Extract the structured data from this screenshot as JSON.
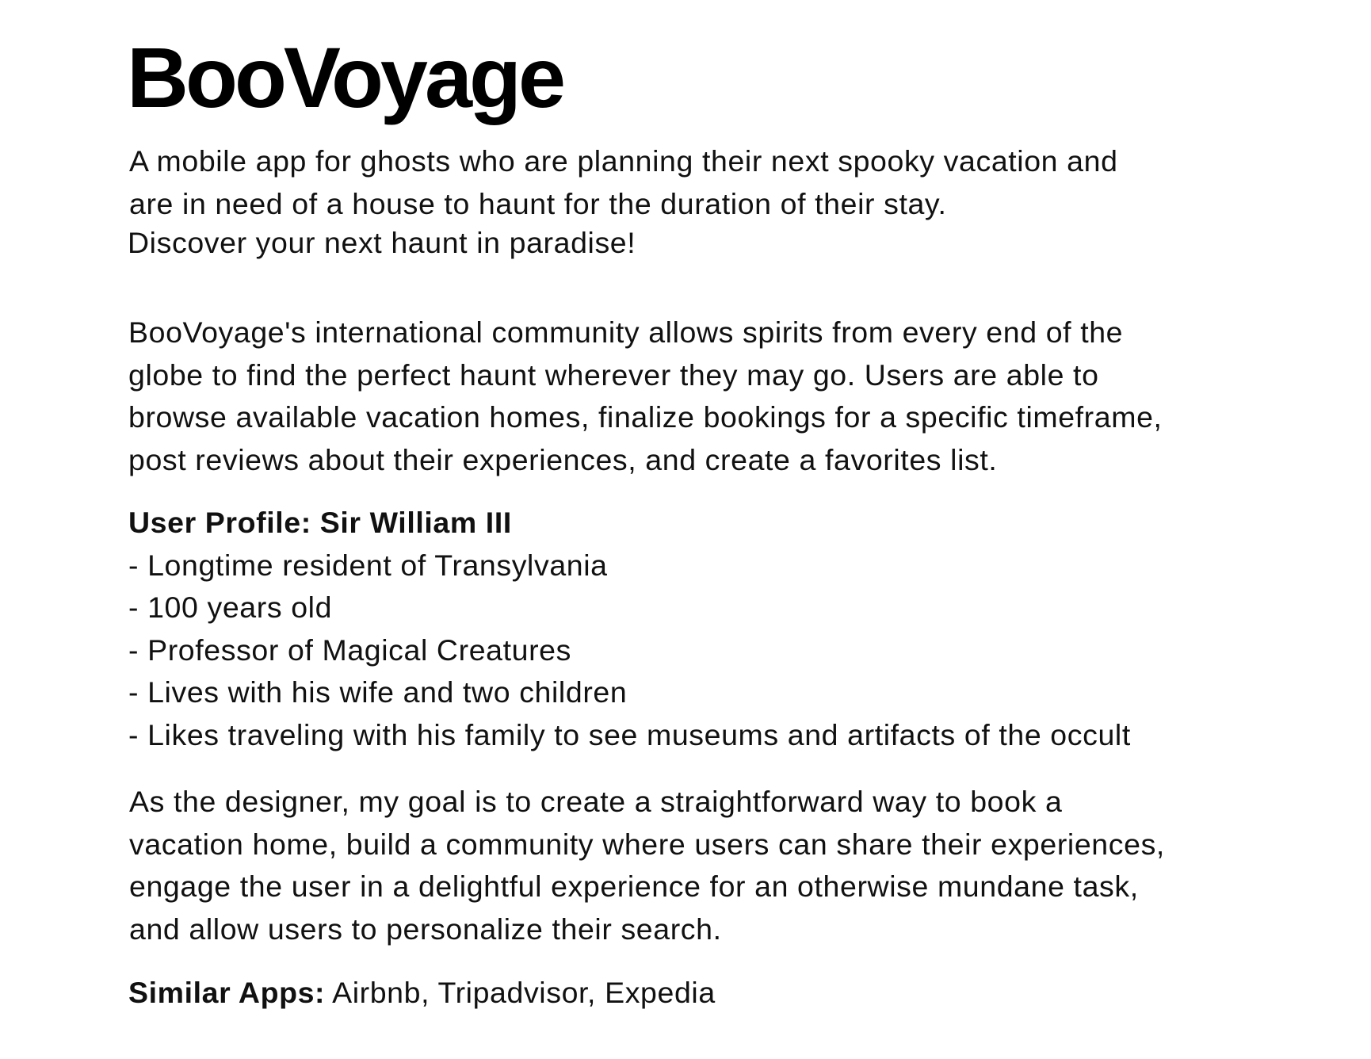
{
  "title": "BooVoyage",
  "intro": [
    "A mobile app for ghosts who are planning their next spooky vacation and",
    "are in need of a house to haunt for the duration of their stay."
  ],
  "tagline": "Discover your next haunt in paradise!",
  "description": [
    "BooVoyage's international community allows spirits from every end of the",
    "globe to find the perfect haunt wherever they may go. Users are able to",
    "browse available vacation homes, finalize bookings for a specific timeframe,",
    "post reviews about their experiences, and create a favorites list."
  ],
  "profile": {
    "heading": "User Profile: Sir William III",
    "items": [
      "- Longtime resident of Transylvania",
      "- 100 years old",
      "- Professor of Magical Creatures",
      "- Lives with his wife and two children",
      "- Likes traveling with his family to see museums and artifacts of the occult"
    ]
  },
  "goal": [
    "As the designer, my goal is to create a straightforward way to book a",
    "vacation home, build a community where users can share their experiences,",
    "engage the user in a delightful experience for an otherwise mundane task,",
    "and allow users to personalize their search."
  ],
  "similar": {
    "label": "Similar Apps:",
    "value": " Airbnb, Tripadvisor, Expedia"
  }
}
